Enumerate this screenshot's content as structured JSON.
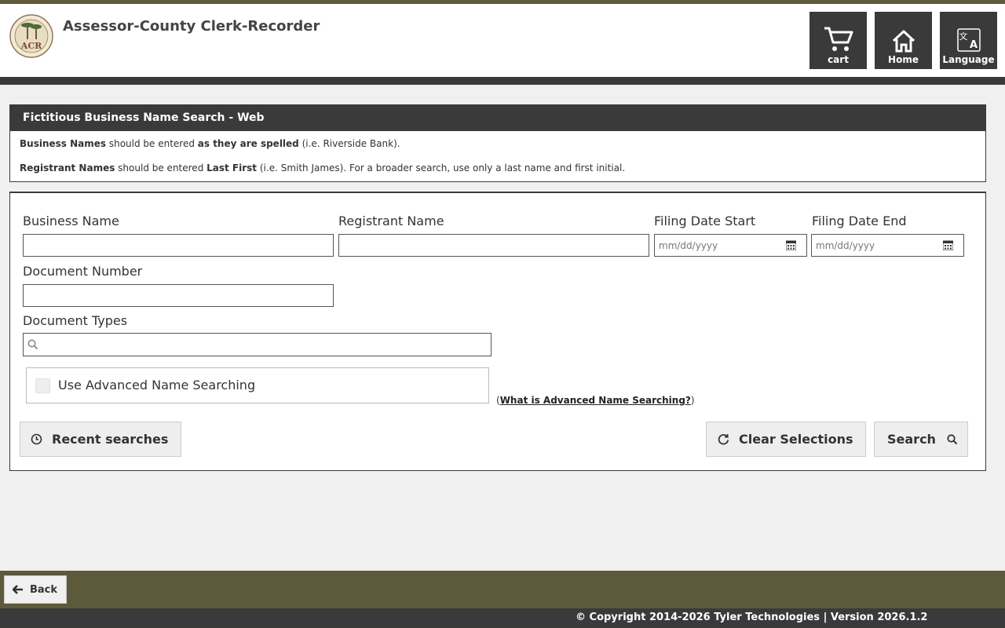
{
  "header": {
    "title": "Assessor-County Clerk-Recorder",
    "logo_text": "ACR",
    "buttons": {
      "cart": "cart",
      "home": "Home",
      "language": "Language"
    }
  },
  "info_panel": {
    "title": "Fictitious Business Name Search - Web",
    "line1": {
      "b1": "Business Names",
      "t1": " should be entered ",
      "b2": "as they are spelled",
      "t2": " (i.e. Riverside Bank)."
    },
    "line2": {
      "b1": "Registrant Names",
      "t1": " should be entered ",
      "b2": "Last First",
      "t2": " (i.e. Smith James). For a broader search, use only a last name and first initial."
    }
  },
  "form": {
    "business_name": {
      "label": "Business Name",
      "value": ""
    },
    "registrant_name": {
      "label": "Registrant Name",
      "value": ""
    },
    "filing_date_start": {
      "label": "Filing Date Start",
      "placeholder": "mm/dd/yyyy"
    },
    "filing_date_end": {
      "label": "Filing Date End",
      "placeholder": "mm/dd/yyyy"
    },
    "document_number": {
      "label": "Document Number",
      "value": ""
    },
    "document_types": {
      "label": "Document Types",
      "value": ""
    },
    "advanced_search": {
      "label": "Use Advanced Name Searching",
      "checked": false
    },
    "advanced_help": {
      "open_paren": "(",
      "link": "What is Advanced Name Searching?",
      "close_paren": ")"
    }
  },
  "actions": {
    "recent": "Recent searches",
    "clear": "Clear Selections",
    "search": "Search"
  },
  "footer": {
    "back": "Back",
    "copyright": "© Copyright 2014-2026 Tyler Technologies | Version 2026.1.2"
  },
  "colors": {
    "olive": "#5c5a3a",
    "charcoal": "#3a3a3a",
    "page_bg": "#f0f0f0"
  }
}
